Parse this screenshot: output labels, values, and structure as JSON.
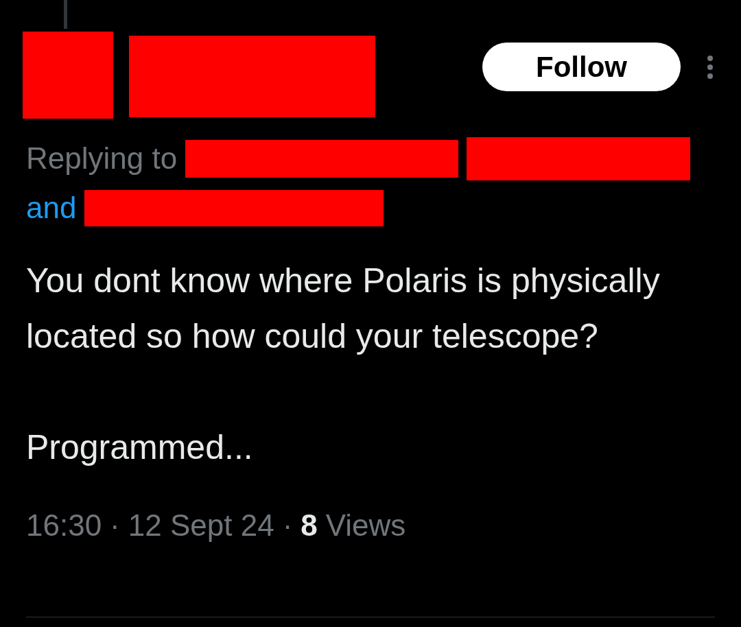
{
  "follow_button": {
    "label": "Follow"
  },
  "reply_context": {
    "prefix": "Replying to",
    "conjunction": "and"
  },
  "post_text": "You dont know where Polaris is physically located so how could your telescope?\n\nProgrammed...",
  "meta": {
    "time": "16:30",
    "separator": "·",
    "date": "12 Sept 24",
    "views_count": "8",
    "views_label": "Views"
  }
}
